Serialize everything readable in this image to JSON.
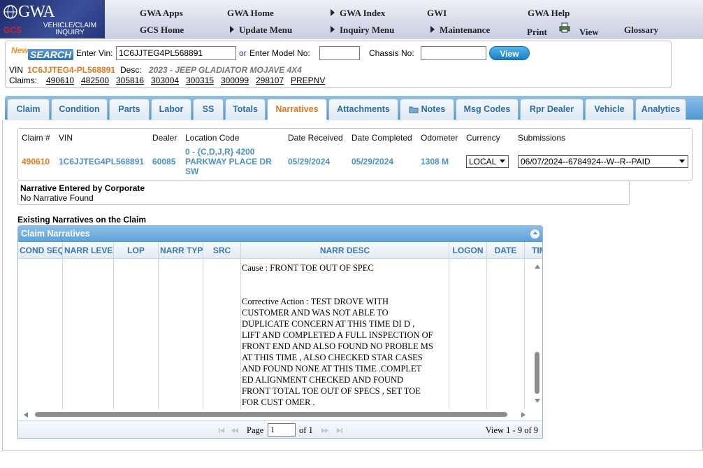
{
  "logo": {
    "gwa": "GWA",
    "gcs": "GCS",
    "vci": "VEHICLE/CLAIM INQUIRY"
  },
  "nav": {
    "gwa_apps": "GWA Apps",
    "gwa_home": "GWA Home",
    "gwa_index": "GWA Index",
    "gwi": "GWI",
    "gwa_help": "GWA Help",
    "gcs_home": "GCS Home",
    "update_menu": "Update Menu",
    "inquiry_menu": "Inquiry Menu",
    "maintenance": "Maintenance",
    "print": "Print",
    "view": "View",
    "glossary": "Glossary"
  },
  "search": {
    "new_label": "New",
    "search_label": "SEARCH",
    "vin_label": "Enter Vin:",
    "vin_value": "1C6JJTEG4PL568891",
    "or": "or",
    "model_label": "Enter Model No:",
    "model_value": "",
    "chassis_label": "Chassis No:",
    "chassis_value": "",
    "view_button": "View",
    "vin_prefix": "VIN",
    "vin_display": "1C6JJTEG4-PL568891",
    "desc_label": "Desc:",
    "desc_value": "2023 - JEEP GLADIATOR MOJAVE 4X4",
    "claims_label": "Claims:",
    "claims": [
      "490610",
      "482500",
      "305816",
      "303004",
      "300315",
      "300099",
      "298107",
      "PREPNV"
    ]
  },
  "tabs": [
    "Claim",
    "Condition",
    "Parts",
    "Labor",
    "SS",
    "Totals",
    "Narratives",
    "Attachments",
    "Notes",
    "Msg Codes",
    "Rpr Dealer",
    "Vehicle",
    "Analytics"
  ],
  "claim": {
    "headers": {
      "claim_no": "Claim #",
      "vin": "VIN",
      "dealer": "Dealer",
      "location": "Location Code",
      "date_received": "Date Received",
      "date_completed": "Date Completed",
      "odometer": "Odometer",
      "currency": "Currency",
      "submissions": "Submissions"
    },
    "claim_no": "490610",
    "vin": "1C6JJTEG4PL568891",
    "dealer": "60085",
    "location_l1": "0 - {C,D,J,R} 4200",
    "location_l2": "PARKWAY PLACE DR",
    "location_l3": "SW",
    "date_received": "05/29/2024",
    "date_completed": "05/29/2024",
    "odometer": "1308 M",
    "currency": "LOCAL",
    "submission": "06/07/2024--6784924--W--R--PAID"
  },
  "corporate": {
    "title": "Narrative Entered by Corporate",
    "value": "No Narrative Found"
  },
  "existing_title": "Existing Narratives on the Claim",
  "grid": {
    "caption": "Claim Narratives",
    "columns": [
      "COND SEQ",
      "NARR LEVEL",
      "LOP",
      "NARR TYPE",
      "SRC",
      "NARR DESC",
      "LOGON",
      "DATE",
      "TIME"
    ],
    "narr_desc": "Cause : FRONT TOE OUT OF SPEC\n\n\nCorrective Action : TEST DROVE WITH\nCUSTOMER AND WAS NOT ABLE TO\nDUPLICATE CONCERN AT THIS TIME DI D ,\nLIFT AND COMPLETED A FULL INSPECTION OF\nFRONT END AND ALSO FOUND NO PROBLE MS\nAT THIS TIME , ALSO CHECKED STAR CASES\nAND FOUND NONE AT THIS TIME .COMPLET\nED ALIGNMENT CHECKED AND FOUND\nFRONT TOTAL TOE OUT OF SPECS , SET TOE\nFOR CUST OMER .",
    "pager": {
      "page_label": "Page",
      "page_value": "1",
      "of_label": "of 1",
      "view_text": "View 1 - 9 of 9"
    }
  }
}
